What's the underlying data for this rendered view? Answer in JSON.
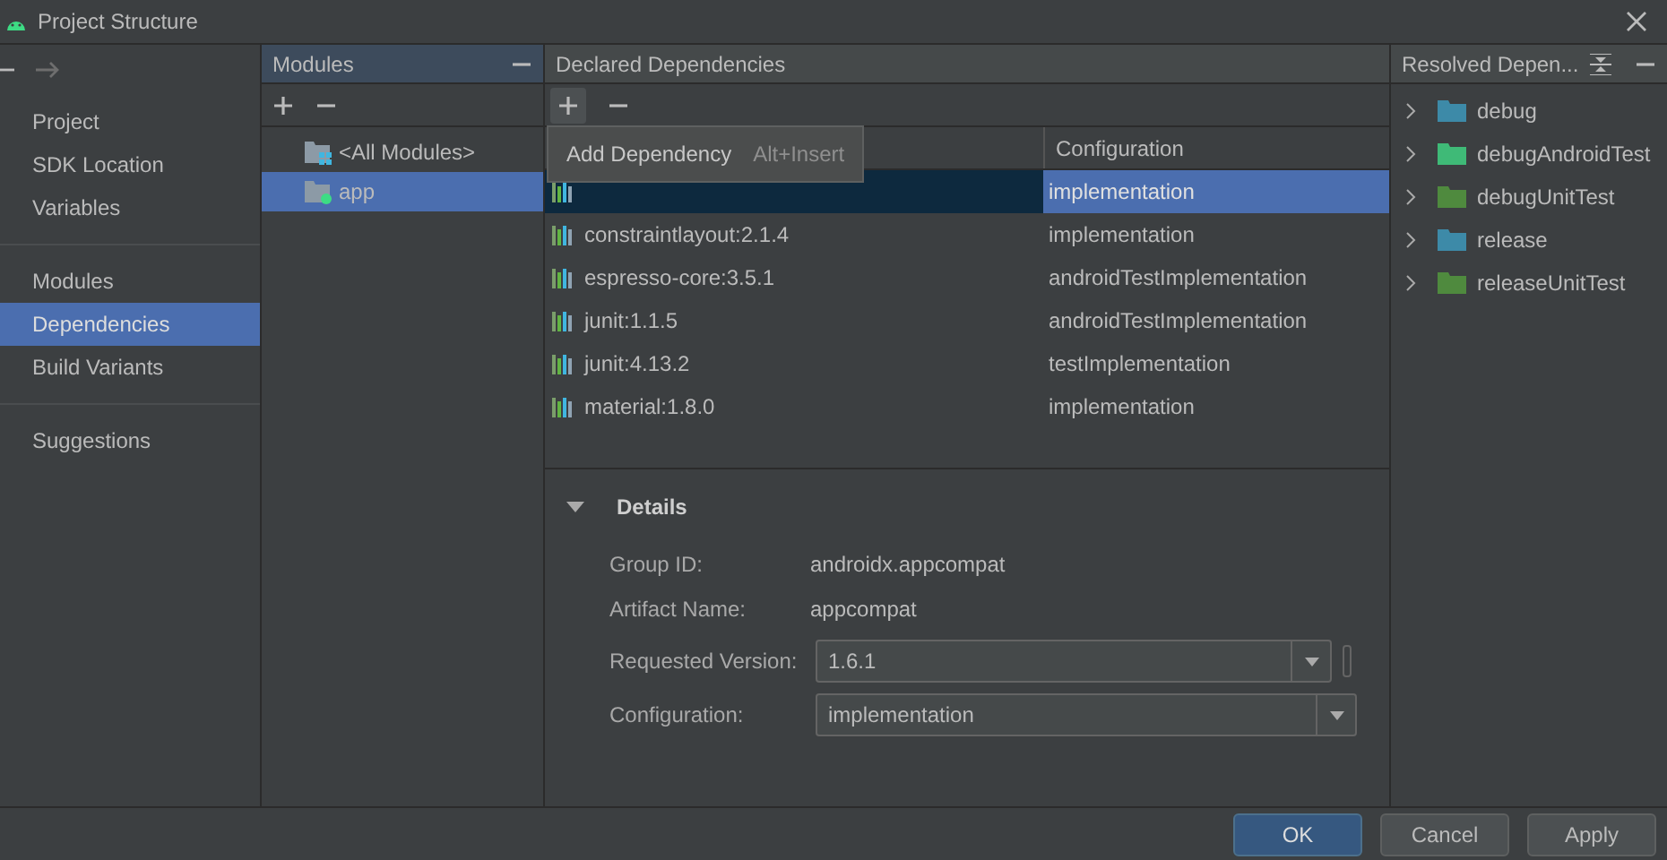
{
  "window": {
    "title": "Project Structure"
  },
  "sidebar": {
    "groups": [
      [
        {
          "label": "Project",
          "selected": false
        },
        {
          "label": "SDK Location",
          "selected": false
        },
        {
          "label": "Variables",
          "selected": false
        }
      ],
      [
        {
          "label": "Modules",
          "selected": false
        },
        {
          "label": "Dependencies",
          "selected": true
        },
        {
          "label": "Build Variants",
          "selected": false
        }
      ],
      [
        {
          "label": "Suggestions",
          "selected": false
        }
      ]
    ]
  },
  "modules": {
    "title": "Modules",
    "items": [
      {
        "label": "<All Modules>",
        "kind": "all",
        "selected": false
      },
      {
        "label": "app",
        "kind": "module",
        "selected": true
      }
    ]
  },
  "dependencies": {
    "title": "Declared Dependencies",
    "column_2": "Configuration",
    "tooltip": {
      "label": "Add Dependency",
      "shortcut": "Alt+Insert"
    },
    "rows": [
      {
        "configuration": "implementation",
        "selected": true
      },
      {
        "name": "constraintlayout:2.1.4",
        "configuration": "implementation",
        "selected": false
      },
      {
        "name": "espresso-core:3.5.1",
        "configuration": "androidTestImplementation",
        "selected": false
      },
      {
        "name": "junit:1.1.5",
        "configuration": "androidTestImplementation",
        "selected": false
      },
      {
        "name": "junit:4.13.2",
        "configuration": "testImplementation",
        "selected": false
      },
      {
        "name": "material:1.8.0",
        "configuration": "implementation",
        "selected": false
      }
    ]
  },
  "details": {
    "title": "Details",
    "expanded": true,
    "group_id_label": "Group ID:",
    "group_id": "androidx.appcompat",
    "artifact_name_label": "Artifact Name:",
    "artifact_name": "appcompat",
    "requested_version_label": "Requested Version:",
    "requested_version": "1.6.1",
    "configuration_label": "Configuration:",
    "configuration": "implementation"
  },
  "resolved": {
    "title": "Resolved Depen...",
    "items": [
      {
        "label": "debug",
        "color": "#3d8aa8",
        "expanded": false
      },
      {
        "label": "debugAndroidTest",
        "color": "#3fba77",
        "expanded": false
      },
      {
        "label": "debugUnitTest",
        "color": "#4f8a3e",
        "expanded": false
      },
      {
        "label": "release",
        "color": "#3d8aa8",
        "expanded": false
      },
      {
        "label": "releaseUnitTest",
        "color": "#4f8a3e",
        "expanded": false
      }
    ]
  },
  "buttons": [
    {
      "label": "OK",
      "kind": "default"
    },
    {
      "label": "Cancel",
      "kind": "normal"
    },
    {
      "label": "Apply",
      "kind": "normal"
    }
  ]
}
